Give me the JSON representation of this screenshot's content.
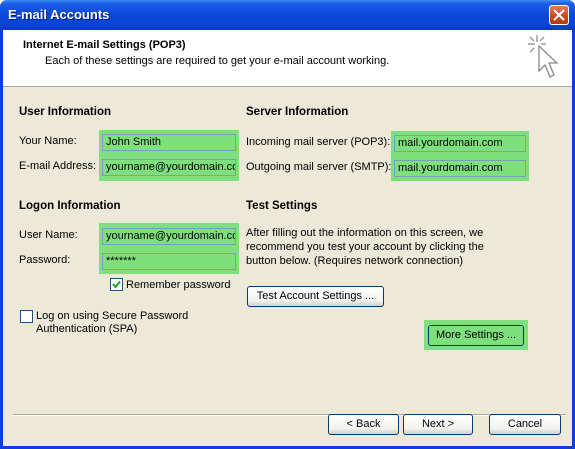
{
  "window": {
    "title": "E-mail Accounts"
  },
  "header": {
    "title": "Internet E-mail Settings (POP3)",
    "subtitle": "Each of these settings are required to get your e-mail account working."
  },
  "user_info": {
    "heading": "User Information",
    "name_label": "Your Name:",
    "name_value": "John Smith",
    "email_label": "E-mail Address:",
    "email_value": "yourname@yourdomain.com"
  },
  "server_info": {
    "heading": "Server Information",
    "incoming_label": "Incoming mail server (POP3):",
    "incoming_value": "mail.yourdomain.com",
    "outgoing_label": "Outgoing mail server (SMTP):",
    "outgoing_value": "mail.yourdomain.com"
  },
  "logon_info": {
    "heading": "Logon Information",
    "username_label": "User Name:",
    "username_value": "yourname@yourdomain.com",
    "password_label": "Password:",
    "password_value": "*******",
    "remember_label": "Remember password",
    "remember_checked": true,
    "spa_label_1": "Log on using Secure Password",
    "spa_label_2": "Authentication (SPA)",
    "spa_checked": false
  },
  "test_settings": {
    "heading": "Test Settings",
    "line1": "After filling out the information on this screen, we",
    "line2": "recommend you test your account by clicking the",
    "line3": "button below. (Requires network connection)",
    "test_button": "Test Account Settings ...",
    "more_button": "More Settings ..."
  },
  "footer": {
    "back_button": "< Back",
    "next_button": "Next >",
    "cancel_button": "Cancel"
  },
  "colors": {
    "highlight": "#7de07d",
    "titlebar": "#0a47d8"
  }
}
